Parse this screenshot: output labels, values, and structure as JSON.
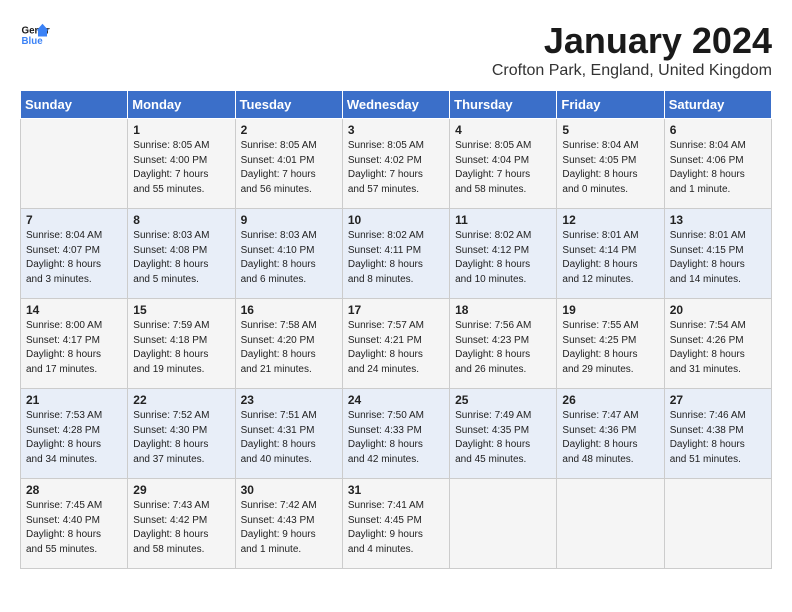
{
  "logo": {
    "line1": "General",
    "line2": "Blue"
  },
  "title": "January 2024",
  "subtitle": "Crofton Park, England, United Kingdom",
  "days_of_week": [
    "Sunday",
    "Monday",
    "Tuesday",
    "Wednesday",
    "Thursday",
    "Friday",
    "Saturday"
  ],
  "weeks": [
    [
      {
        "num": "",
        "info": ""
      },
      {
        "num": "1",
        "info": "Sunrise: 8:05 AM\nSunset: 4:00 PM\nDaylight: 7 hours\nand 55 minutes."
      },
      {
        "num": "2",
        "info": "Sunrise: 8:05 AM\nSunset: 4:01 PM\nDaylight: 7 hours\nand 56 minutes."
      },
      {
        "num": "3",
        "info": "Sunrise: 8:05 AM\nSunset: 4:02 PM\nDaylight: 7 hours\nand 57 minutes."
      },
      {
        "num": "4",
        "info": "Sunrise: 8:05 AM\nSunset: 4:04 PM\nDaylight: 7 hours\nand 58 minutes."
      },
      {
        "num": "5",
        "info": "Sunrise: 8:04 AM\nSunset: 4:05 PM\nDaylight: 8 hours\nand 0 minutes."
      },
      {
        "num": "6",
        "info": "Sunrise: 8:04 AM\nSunset: 4:06 PM\nDaylight: 8 hours\nand 1 minute."
      }
    ],
    [
      {
        "num": "7",
        "info": "Sunrise: 8:04 AM\nSunset: 4:07 PM\nDaylight: 8 hours\nand 3 minutes."
      },
      {
        "num": "8",
        "info": "Sunrise: 8:03 AM\nSunset: 4:08 PM\nDaylight: 8 hours\nand 5 minutes."
      },
      {
        "num": "9",
        "info": "Sunrise: 8:03 AM\nSunset: 4:10 PM\nDaylight: 8 hours\nand 6 minutes."
      },
      {
        "num": "10",
        "info": "Sunrise: 8:02 AM\nSunset: 4:11 PM\nDaylight: 8 hours\nand 8 minutes."
      },
      {
        "num": "11",
        "info": "Sunrise: 8:02 AM\nSunset: 4:12 PM\nDaylight: 8 hours\nand 10 minutes."
      },
      {
        "num": "12",
        "info": "Sunrise: 8:01 AM\nSunset: 4:14 PM\nDaylight: 8 hours\nand 12 minutes."
      },
      {
        "num": "13",
        "info": "Sunrise: 8:01 AM\nSunset: 4:15 PM\nDaylight: 8 hours\nand 14 minutes."
      }
    ],
    [
      {
        "num": "14",
        "info": "Sunrise: 8:00 AM\nSunset: 4:17 PM\nDaylight: 8 hours\nand 17 minutes."
      },
      {
        "num": "15",
        "info": "Sunrise: 7:59 AM\nSunset: 4:18 PM\nDaylight: 8 hours\nand 19 minutes."
      },
      {
        "num": "16",
        "info": "Sunrise: 7:58 AM\nSunset: 4:20 PM\nDaylight: 8 hours\nand 21 minutes."
      },
      {
        "num": "17",
        "info": "Sunrise: 7:57 AM\nSunset: 4:21 PM\nDaylight: 8 hours\nand 24 minutes."
      },
      {
        "num": "18",
        "info": "Sunrise: 7:56 AM\nSunset: 4:23 PM\nDaylight: 8 hours\nand 26 minutes."
      },
      {
        "num": "19",
        "info": "Sunrise: 7:55 AM\nSunset: 4:25 PM\nDaylight: 8 hours\nand 29 minutes."
      },
      {
        "num": "20",
        "info": "Sunrise: 7:54 AM\nSunset: 4:26 PM\nDaylight: 8 hours\nand 31 minutes."
      }
    ],
    [
      {
        "num": "21",
        "info": "Sunrise: 7:53 AM\nSunset: 4:28 PM\nDaylight: 8 hours\nand 34 minutes."
      },
      {
        "num": "22",
        "info": "Sunrise: 7:52 AM\nSunset: 4:30 PM\nDaylight: 8 hours\nand 37 minutes."
      },
      {
        "num": "23",
        "info": "Sunrise: 7:51 AM\nSunset: 4:31 PM\nDaylight: 8 hours\nand 40 minutes."
      },
      {
        "num": "24",
        "info": "Sunrise: 7:50 AM\nSunset: 4:33 PM\nDaylight: 8 hours\nand 42 minutes."
      },
      {
        "num": "25",
        "info": "Sunrise: 7:49 AM\nSunset: 4:35 PM\nDaylight: 8 hours\nand 45 minutes."
      },
      {
        "num": "26",
        "info": "Sunrise: 7:47 AM\nSunset: 4:36 PM\nDaylight: 8 hours\nand 48 minutes."
      },
      {
        "num": "27",
        "info": "Sunrise: 7:46 AM\nSunset: 4:38 PM\nDaylight: 8 hours\nand 51 minutes."
      }
    ],
    [
      {
        "num": "28",
        "info": "Sunrise: 7:45 AM\nSunset: 4:40 PM\nDaylight: 8 hours\nand 55 minutes."
      },
      {
        "num": "29",
        "info": "Sunrise: 7:43 AM\nSunset: 4:42 PM\nDaylight: 8 hours\nand 58 minutes."
      },
      {
        "num": "30",
        "info": "Sunrise: 7:42 AM\nSunset: 4:43 PM\nDaylight: 9 hours\nand 1 minute."
      },
      {
        "num": "31",
        "info": "Sunrise: 7:41 AM\nSunset: 4:45 PM\nDaylight: 9 hours\nand 4 minutes."
      },
      {
        "num": "",
        "info": ""
      },
      {
        "num": "",
        "info": ""
      },
      {
        "num": "",
        "info": ""
      }
    ]
  ]
}
